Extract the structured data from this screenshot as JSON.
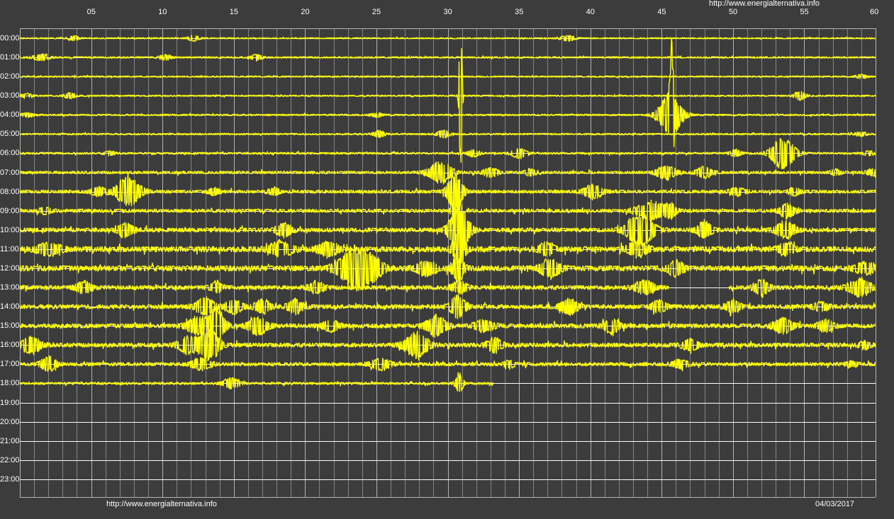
{
  "chart_data": {
    "type": "line",
    "title": "",
    "header_url": "http://www.energialternativa.info",
    "footer_url": "http://www.energialternativa.info",
    "date": "04/03/2017",
    "x_ticks": [
      "05",
      "10",
      "15",
      "20",
      "25",
      "30",
      "35",
      "40",
      "45",
      "50",
      "55",
      "60"
    ],
    "xlim": [
      0,
      60
    ],
    "y_ticks": [
      "00:00",
      "01:00",
      "02:00",
      "03:00",
      "04:00",
      "05:00",
      "06:00",
      "07:00",
      "08:00",
      "09:00",
      "10:00",
      "11:00",
      "12:00",
      "13:00",
      "14:00",
      "15:00",
      "16:00",
      "17:00",
      "18:00",
      "19:00",
      "20:00",
      "21:00",
      "22:00",
      "23:00"
    ],
    "grid": true,
    "colors": {
      "background": "#3c3c3c",
      "grid": "#b4b4b4",
      "trace": "#ffff00",
      "text": "#ffffff",
      "baseline": "#ffffff"
    },
    "traces": [
      {
        "hour": "00:00",
        "noise": 0.7,
        "end_minute": 60,
        "events": [
          [
            3.8,
            3,
            0.3
          ],
          [
            12.2,
            4,
            0.3
          ],
          [
            38.4,
            4,
            0.4
          ]
        ]
      },
      {
        "hour": "01:00",
        "noise": 0.9,
        "end_minute": 60,
        "events": [
          [
            1.5,
            5,
            0.4
          ],
          [
            10.2,
            4,
            0.3
          ],
          [
            16.6,
            4,
            0.3
          ]
        ]
      },
      {
        "hour": "02:00",
        "noise": 0.8,
        "end_minute": 60,
        "events": [
          [
            59.0,
            3,
            0.3
          ]
        ]
      },
      {
        "hour": "03:00",
        "noise": 0.8,
        "end_minute": 60,
        "events": [
          [
            0.5,
            3,
            0.3
          ],
          [
            3.5,
            4,
            0.3
          ],
          [
            30.9,
            120,
            0.08
          ],
          [
            54.7,
            6,
            0.3
          ]
        ]
      },
      {
        "hour": "04:00",
        "noise": 0.9,
        "end_minute": 60,
        "events": [
          [
            0.5,
            3,
            0.3
          ],
          [
            25.0,
            3,
            0.3
          ],
          [
            45.6,
            30,
            0.6
          ],
          [
            45.7,
            80,
            0.1
          ]
        ]
      },
      {
        "hour": "05:00",
        "noise": 0.9,
        "end_minute": 60,
        "events": [
          [
            25.2,
            5,
            0.3
          ],
          [
            29.7,
            6,
            0.3
          ],
          [
            59.0,
            3,
            0.3
          ]
        ]
      },
      {
        "hour": "06:00",
        "noise": 1.1,
        "end_minute": 60,
        "events": [
          [
            6.3,
            3,
            0.3
          ],
          [
            31.8,
            5,
            0.3
          ],
          [
            35.0,
            7,
            0.4
          ],
          [
            50.2,
            5,
            0.3
          ],
          [
            53.5,
            22,
            0.6
          ],
          [
            59.5,
            3,
            0.3
          ]
        ]
      },
      {
        "hour": "07:00",
        "noise": 1.5,
        "end_minute": 60,
        "events": [
          [
            29.5,
            15,
            0.6
          ],
          [
            33.0,
            6,
            0.4
          ],
          [
            35.8,
            5,
            0.3
          ],
          [
            45.3,
            10,
            0.5
          ],
          [
            48.0,
            8,
            0.4
          ],
          [
            57.2,
            4,
            0.3
          ],
          [
            59.8,
            5,
            0.3
          ]
        ]
      },
      {
        "hour": "08:00",
        "noise": 1.8,
        "end_minute": 60,
        "events": [
          [
            7.6,
            22,
            0.6
          ],
          [
            5.5,
            6,
            0.4
          ],
          [
            13.6,
            5,
            0.3
          ],
          [
            17.8,
            5,
            0.3
          ],
          [
            30.5,
            25,
            0.4
          ],
          [
            40.2,
            10,
            0.5
          ],
          [
            50.3,
            5,
            0.4
          ],
          [
            54.3,
            5,
            0.3
          ]
        ]
      },
      {
        "hour": "09:00",
        "noise": 1.9,
        "end_minute": 60,
        "events": [
          [
            1.8,
            5,
            0.3
          ],
          [
            30.6,
            40,
            0.2
          ],
          [
            44.3,
            12,
            0.8
          ],
          [
            45.6,
            8,
            0.3
          ],
          [
            53.8,
            10,
            0.4
          ]
        ]
      },
      {
        "hour": "10:00",
        "noise": 2.3,
        "end_minute": 60,
        "events": [
          [
            7.4,
            10,
            0.4
          ],
          [
            18.5,
            10,
            0.4
          ],
          [
            30.8,
            35,
            0.5
          ],
          [
            43.5,
            22,
            0.7
          ],
          [
            48.0,
            12,
            0.4
          ],
          [
            53.7,
            12,
            0.5
          ]
        ]
      },
      {
        "hour": "11:00",
        "noise": 3.0,
        "end_minute": 60,
        "events": [
          [
            2.0,
            8,
            0.6
          ],
          [
            18.3,
            10,
            0.6
          ],
          [
            21.6,
            10,
            0.5
          ],
          [
            30.8,
            25,
            0.3
          ],
          [
            36.9,
            8,
            0.4
          ],
          [
            43.3,
            10,
            0.5
          ],
          [
            53.7,
            8,
            0.4
          ]
        ]
      },
      {
        "hour": "12:00",
        "noise": 3.0,
        "end_minute": 60,
        "events": [
          [
            23.5,
            30,
            0.8
          ],
          [
            24.8,
            12,
            0.5
          ],
          [
            28.5,
            10,
            0.5
          ],
          [
            30.7,
            20,
            0.3
          ],
          [
            37.2,
            12,
            0.5
          ],
          [
            46.0,
            10,
            0.4
          ],
          [
            59.3,
            8,
            0.5
          ]
        ]
      },
      {
        "hour": "13:00",
        "noise": 2.3,
        "end_minute": 60,
        "gap": [
          45.5,
          49.7
        ],
        "events": [
          [
            4.5,
            8,
            0.4
          ],
          [
            13.8,
            8,
            0.3
          ],
          [
            20.8,
            8,
            0.4
          ],
          [
            30.8,
            8,
            0.4
          ],
          [
            43.8,
            10,
            0.5
          ],
          [
            52.0,
            10,
            0.4
          ],
          [
            58.9,
            12,
            0.6
          ]
        ]
      },
      {
        "hour": "14:00",
        "noise": 2.3,
        "end_minute": 60,
        "events": [
          [
            13.0,
            12,
            0.5
          ],
          [
            15.0,
            10,
            0.4
          ],
          [
            17.0,
            10,
            0.4
          ],
          [
            19.3,
            10,
            0.4
          ],
          [
            30.7,
            15,
            0.4
          ],
          [
            38.5,
            10,
            0.5
          ],
          [
            44.8,
            8,
            0.4
          ],
          [
            50.0,
            8,
            0.4
          ],
          [
            56.2,
            6,
            0.4
          ]
        ]
      },
      {
        "hour": "15:00",
        "noise": 2.4,
        "end_minute": 60,
        "events": [
          [
            12.5,
            12,
            0.6
          ],
          [
            13.8,
            25,
            0.4
          ],
          [
            16.7,
            12,
            0.5
          ],
          [
            21.8,
            8,
            0.4
          ],
          [
            29.2,
            15,
            0.5
          ],
          [
            32.5,
            8,
            0.5
          ],
          [
            41.5,
            10,
            0.4
          ],
          [
            53.5,
            10,
            0.5
          ],
          [
            56.5,
            8,
            0.4
          ]
        ]
      },
      {
        "hour": "16:00",
        "noise": 2.3,
        "end_minute": 60,
        "events": [
          [
            0.8,
            12,
            0.5
          ],
          [
            11.8,
            12,
            0.5
          ],
          [
            13.3,
            22,
            0.5
          ],
          [
            27.8,
            18,
            0.6
          ],
          [
            33.3,
            10,
            0.4
          ],
          [
            47.0,
            8,
            0.4
          ],
          [
            59.2,
            5,
            0.3
          ]
        ]
      },
      {
        "hour": "17:00",
        "noise": 1.9,
        "end_minute": 60,
        "events": [
          [
            2.0,
            10,
            0.4
          ],
          [
            12.7,
            8,
            0.5
          ],
          [
            25.3,
            8,
            0.5
          ],
          [
            34.3,
            5,
            0.3
          ],
          [
            46.3,
            6,
            0.4
          ],
          [
            58.3,
            4,
            0.3
          ]
        ]
      },
      {
        "hour": "18:00",
        "noise": 1.3,
        "end_minute": 33.2,
        "events": [
          [
            14.8,
            8,
            0.4
          ],
          [
            30.8,
            15,
            0.2
          ]
        ]
      }
    ]
  }
}
